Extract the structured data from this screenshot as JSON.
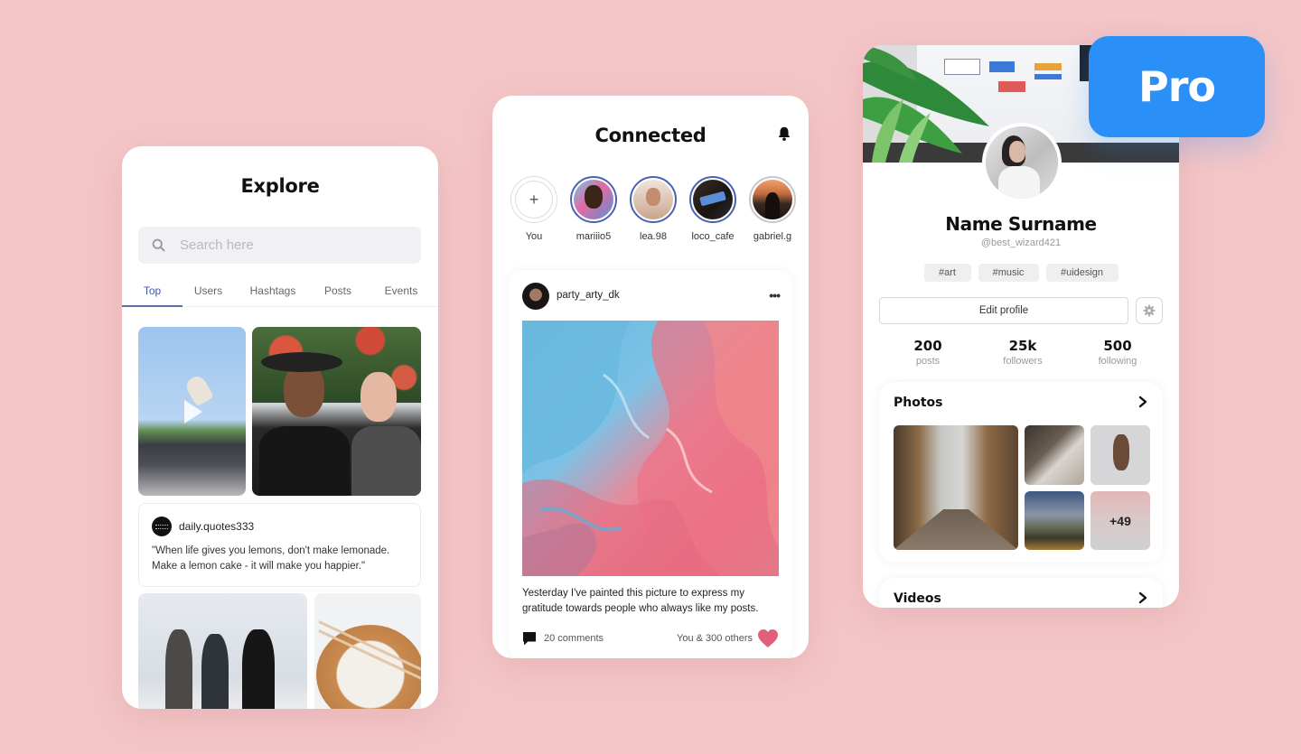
{
  "colors": {
    "background": "#f4c6c7",
    "accent": "#3e5aa6",
    "pro_badge": "#2a8ff7",
    "heart": "#e0607a"
  },
  "explore": {
    "title": "Explore",
    "search": {
      "placeholder": "Search here",
      "value": ""
    },
    "tabs": [
      {
        "label": "Top",
        "active": true
      },
      {
        "label": "Users",
        "active": false
      },
      {
        "label": "Hashtags",
        "active": false
      },
      {
        "label": "Posts",
        "active": false
      },
      {
        "label": "Events",
        "active": false
      }
    ],
    "tiles": [
      {
        "type": "video",
        "subject": "skateboarder mid-air"
      },
      {
        "type": "photo",
        "subject": "smiling couple under flowers"
      },
      {
        "type": "photo",
        "subject": "friends jumping"
      },
      {
        "type": "photo",
        "subject": "dumplings with chopsticks"
      }
    ],
    "quote_post": {
      "user": "daily.quotes333",
      "text": "\"When life gives you lemons, don't make lemonade. Make a lemon cake - it will make you happier.\""
    }
  },
  "connected": {
    "title": "Connected",
    "bell_icon": "bell-icon",
    "stories": [
      {
        "label": "You",
        "type": "add"
      },
      {
        "label": "mariiio5",
        "type": "unseen"
      },
      {
        "label": "lea.98",
        "type": "unseen"
      },
      {
        "label": "loco_cafe",
        "type": "unseen"
      },
      {
        "label": "gabriel.g",
        "type": "seen"
      }
    ],
    "add_symbol": "+",
    "post": {
      "user": "party_arty_dk",
      "more_symbol": "•••",
      "caption": "Yesterday I've painted this picture to express my gratitude towards people who always like my posts.",
      "comments": "20 comments",
      "likes": "You & 300 others"
    }
  },
  "profile": {
    "name": "Name Surname",
    "handle": "@best_wizard421",
    "tags": [
      "#art",
      "#music",
      "#uidesign"
    ],
    "edit_button": "Edit profile",
    "stats": [
      {
        "value": "200",
        "label": "posts"
      },
      {
        "value": "25k",
        "label": "followers"
      },
      {
        "value": "500",
        "label": "following"
      }
    ],
    "photos": {
      "title": "Photos",
      "more_count": "+49"
    },
    "videos": {
      "title": "Videos"
    }
  },
  "badge": {
    "label": "Pro"
  }
}
